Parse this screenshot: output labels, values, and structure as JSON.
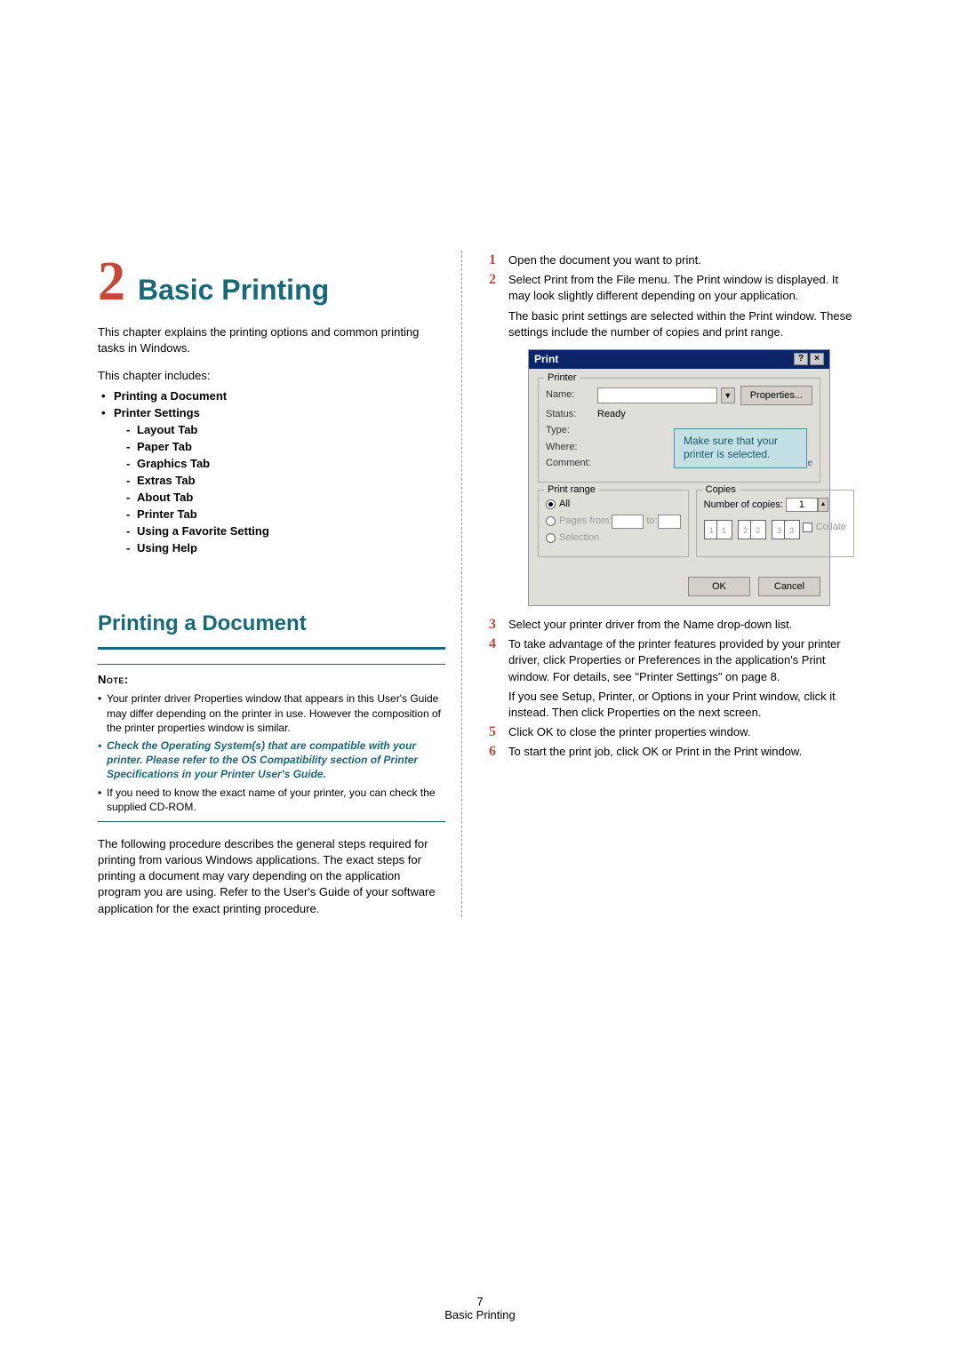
{
  "chapter": {
    "number": "2",
    "title": "Basic Printing"
  },
  "intro1": "This chapter explains the printing options and common printing tasks in Windows.",
  "intro2": "This chapter includes:",
  "toc": [
    "Printing a Document",
    "Printer Settings"
  ],
  "toc_sub": [
    "Layout Tab",
    "Paper Tab",
    "Graphics Tab",
    "Extras Tab",
    "About Tab",
    "Printer Tab",
    "Using a Favorite Setting",
    "Using Help"
  ],
  "section_title": "Printing a Document",
  "note_label": "Note",
  "notes": {
    "n1": "Your printer driver Properties window that appears in this User's Guide may differ depending on the printer in use. However the composition of the printer properties window is similar.",
    "n2": "Check the Operating System(s) that are compatible with your printer. Please refer to the OS Compatibility section of Printer Specifications in your Printer User's Guide.",
    "n3": "If you need to know the exact name of your printer, you can check the supplied CD-ROM."
  },
  "body1": "The following procedure describes the general steps required for printing from various Windows applications. The exact steps for printing a document may vary depending on the application program you are using. Refer to the User's Guide of your software application for the exact printing procedure.",
  "steps": {
    "s1": "Open the document you want to print.",
    "s2a": "Select Print from the File menu. The Print window is displayed. It may look slightly different depending on your application.",
    "s2b": "The basic print settings are selected within the Print window. These settings include the number of copies and print range.",
    "s3": "Select your printer driver from the Name drop-down list.",
    "s4a": "To take advantage of the printer features provided by your printer driver, click Properties or Preferences in the application's Print window. For details, see \"Printer Settings\" on page 8.",
    "s4b": "If you see Setup, Printer, or Options in your Print window, click it instead. Then click Properties on the next screen.",
    "s5": "Click OK to close the printer properties window.",
    "s6": "To start the print job, click OK or Print in the Print window."
  },
  "dialog": {
    "title": "Print",
    "printer_box": "Printer",
    "name_label": "Name:",
    "properties_btn": "Properties...",
    "status_label": "Status:",
    "status_value": "Ready",
    "type_label": "Type:",
    "where_label": "Where:",
    "comment_label": "Comment:",
    "print_to_file": "Print to file",
    "callout": "Make sure that your printer is selected.",
    "range_box": "Print range",
    "range_all": "All",
    "range_pages": "Pages",
    "range_from": "from:",
    "range_to": "to:",
    "range_selection": "Selection",
    "copies_box": "Copies",
    "copies_label": "Number of copies:",
    "copies_value": "1",
    "collate": "Collate",
    "ok": "OK",
    "cancel": "Cancel"
  },
  "footer": {
    "page": "7",
    "title": "Basic Printing"
  }
}
